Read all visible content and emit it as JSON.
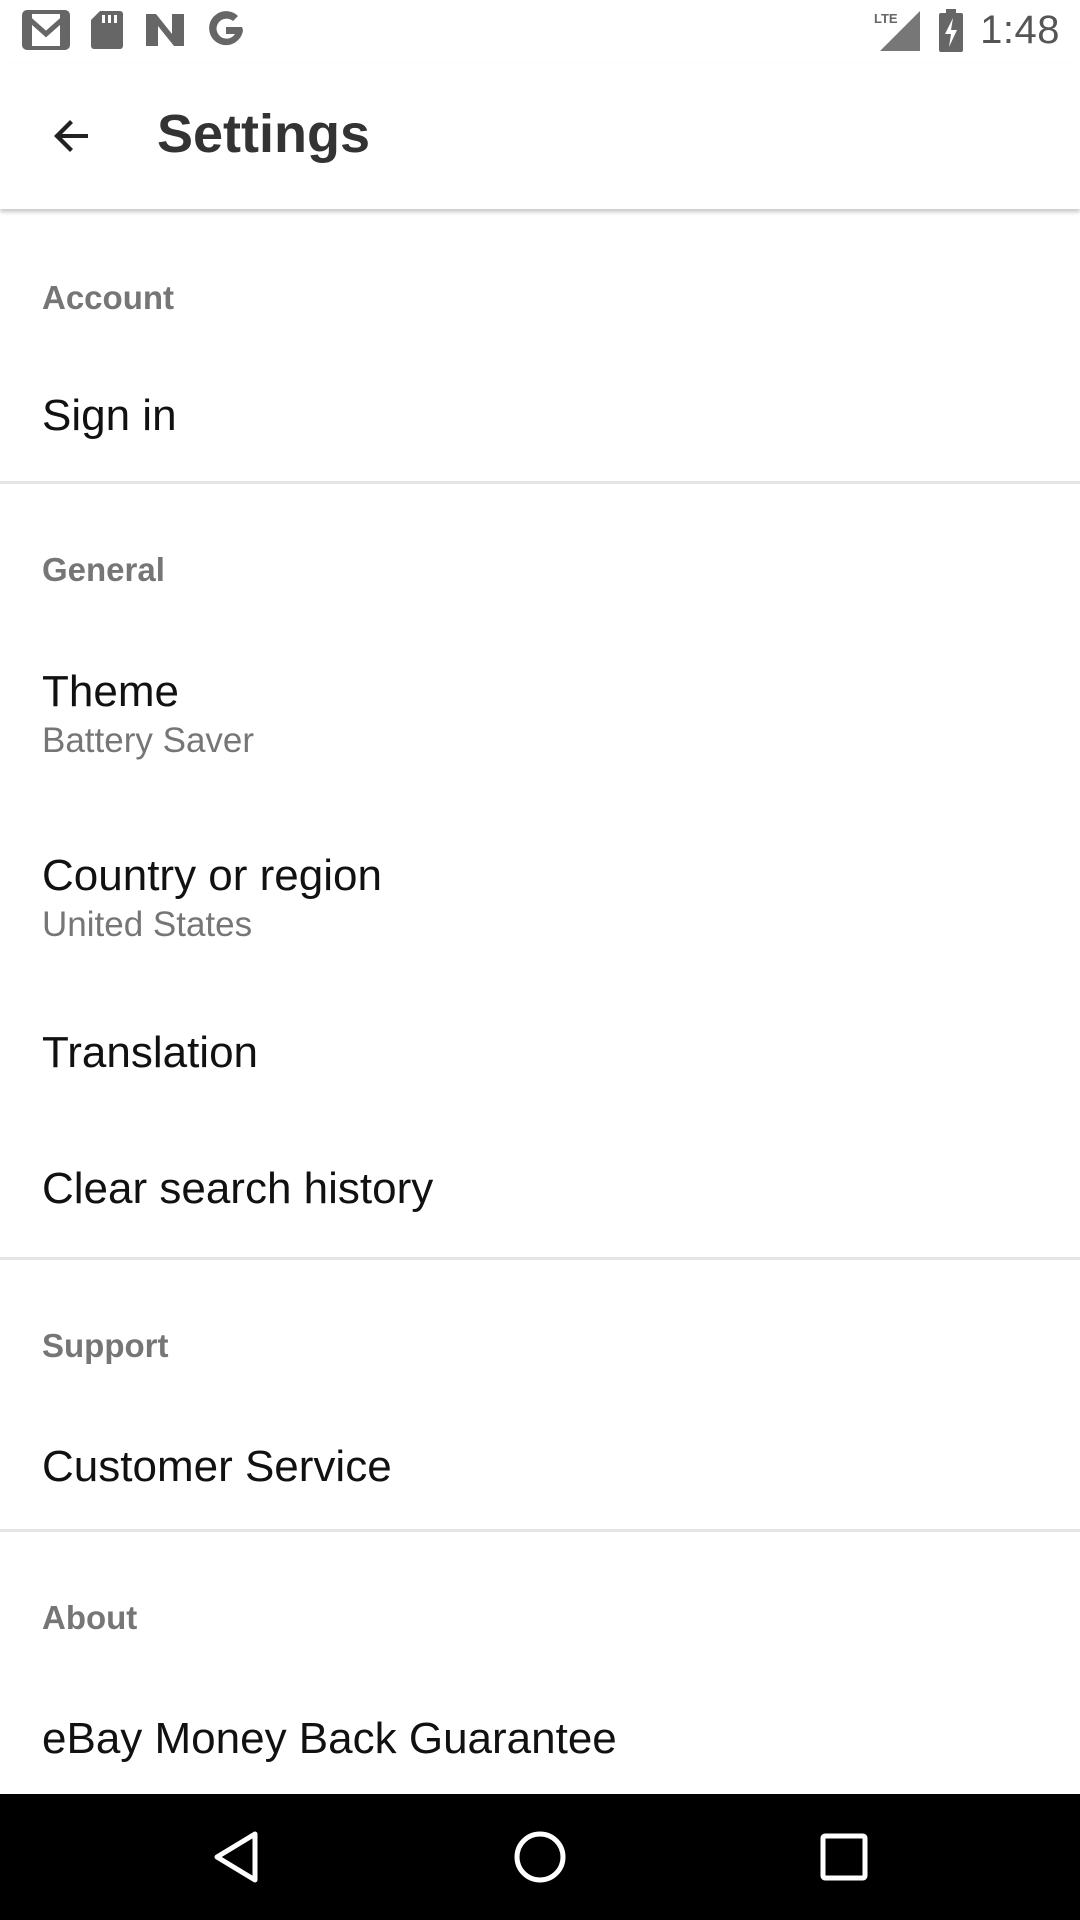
{
  "status_bar": {
    "time": "1:48",
    "network": "LTE",
    "left_icons": [
      "gmail-icon",
      "sd-card-icon",
      "n-app-icon",
      "google-icon"
    ],
    "right_icons": [
      "lte-signal-icon",
      "battery-charging-icon"
    ]
  },
  "app_bar": {
    "back_icon": "arrow-back-icon",
    "title": "Settings"
  },
  "sections": {
    "account": {
      "header": "Account",
      "items": [
        {
          "title": "Sign in"
        }
      ]
    },
    "general": {
      "header": "General",
      "items": [
        {
          "title": "Theme",
          "subtitle": "Battery Saver"
        },
        {
          "title": "Country or region",
          "subtitle": "United States"
        },
        {
          "title": "Translation"
        },
        {
          "title": "Clear search history"
        }
      ]
    },
    "support": {
      "header": "Support",
      "items": [
        {
          "title": "Customer Service"
        }
      ]
    },
    "about": {
      "header": "About",
      "items": [
        {
          "title": "eBay Money Back Guarantee"
        }
      ]
    }
  },
  "nav_bar": {
    "buttons": [
      "back-triangle-icon",
      "home-circle-icon",
      "recents-square-icon"
    ]
  },
  "colors": {
    "background": "#ffffff",
    "title_text": "#333333",
    "item_text": "#111111",
    "secondary_text": "#767676",
    "divider": "#e5e5e5",
    "nav_bar": "#000000"
  }
}
